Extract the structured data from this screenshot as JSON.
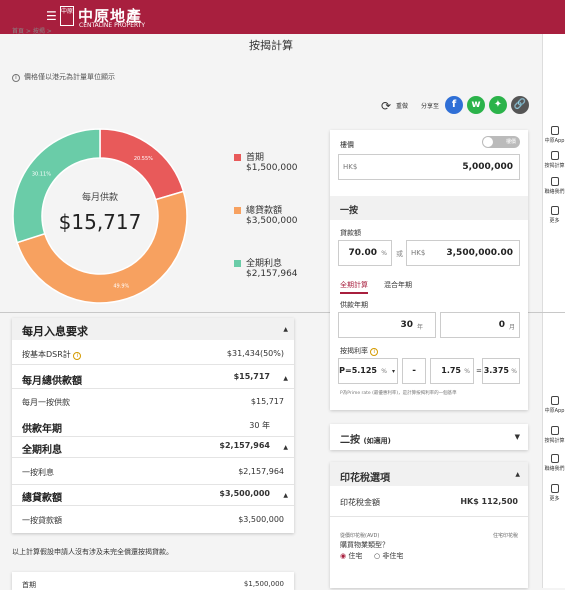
{
  "header": {
    "menu_icon": "☰",
    "logo_box": "中原",
    "logo_cn": "中原地產",
    "logo_en": "CENTALINE PROPERTY"
  },
  "breadcrumb": "首頁 > 按揭 >",
  "page_title": "按揭計算",
  "note": "價格僅以港元為計量單位顯示",
  "share": {
    "redo_label": "重做",
    "share_label": "分享至",
    "facebook": "f",
    "whatsapp": "w",
    "wechat": "✦",
    "link": "🔗"
  },
  "rightnav": {
    "items": [
      "中原App",
      "按揭計算",
      "聯絡我們",
      "更多"
    ],
    "items2": [
      "中原App",
      "按揭計算",
      "聯絡我們",
      "更多"
    ]
  },
  "chart_data": {
    "type": "pie",
    "title": "每月供款",
    "center_value": "$15,717",
    "series": [
      {
        "name": "首期",
        "value": 1500000,
        "percent": 20.55,
        "label": "20.55%",
        "color": "#e85a5a"
      },
      {
        "name": "總貸款額",
        "value": 3500000,
        "percent": 49.9,
        "label": "49.9%",
        "color": "#f7a160"
      },
      {
        "name": "全期利息",
        "value": 2157964,
        "percent": 30.11,
        "label": "30.11%",
        "color": "#6acca8"
      }
    ]
  },
  "legend": [
    {
      "label": "首期",
      "value": "$1,500,000",
      "color": "#e85a5a"
    },
    {
      "label": "總貸款額",
      "value": "$3,500,000",
      "color": "#f7a160"
    },
    {
      "label": "全期利息",
      "value": "$2,157,964",
      "color": "#6acca8"
    }
  ],
  "summary": {
    "monthly_income_title": "每月入息要求",
    "dsr_label": "按基本DSR計",
    "dsr_value": "$31,434(50%)",
    "monthly_total_title": "每月總供款額",
    "monthly_total_value": "$15,717",
    "monthly_first_label": "每月一按供款",
    "monthly_first_value": "$15,717",
    "term_title": "供款年期",
    "term_value": "30 年",
    "interest_title": "全期利息",
    "interest_value": "$2,157,964",
    "first_interest_label": "一按利息",
    "first_interest_value": "$2,157,964",
    "loan_title": "總貸款額",
    "loan_value": "$3,500,000",
    "first_loan_label": "一按貸款額",
    "first_loan_value": "$3,500,000"
  },
  "disclaimer": "以上計算假設申請人沒有涉及未完全償還按揭貸款。",
  "bottom_left": {
    "label": "首期",
    "value": "$1,500,000"
  },
  "form": {
    "price_label": "樓價",
    "toggle_label": "樓價",
    "price_prefix": "HK$",
    "price_value": "5,000,000",
    "first_mortgage_title": "一按",
    "loan_amount_label": "貸款額",
    "loan_percent": "70.00",
    "percent_unit": "%",
    "or_label": "或",
    "loan_prefix": "HK$",
    "loan_value": "3,500,000.00",
    "tab_full": "全期計算",
    "tab_mixed": "混合年期",
    "term_label": "供款年期",
    "term_years": "30",
    "year_unit": "年",
    "term_months": "0",
    "month_unit": "月",
    "rate_label": "按揭利率",
    "p_rate": "P=5.125",
    "dash": "-",
    "spread": "1.75",
    "result_rate": "3.375",
    "rate_note": "P為Prime rate (最優惠利率)，是計算按揭利率的一個基準"
  },
  "second": {
    "title": "二按",
    "sub": "(如適用)"
  },
  "stamp": {
    "title": "印花稅選項",
    "amount_label": "印花稅金額",
    "amount_value": "HK$ 112,500",
    "avd_label": "從價印花稅(AVD)",
    "type_label": "住宅印花稅",
    "question": "購買物業類型？",
    "opt1": "住宅",
    "opt2": "非住宅"
  }
}
